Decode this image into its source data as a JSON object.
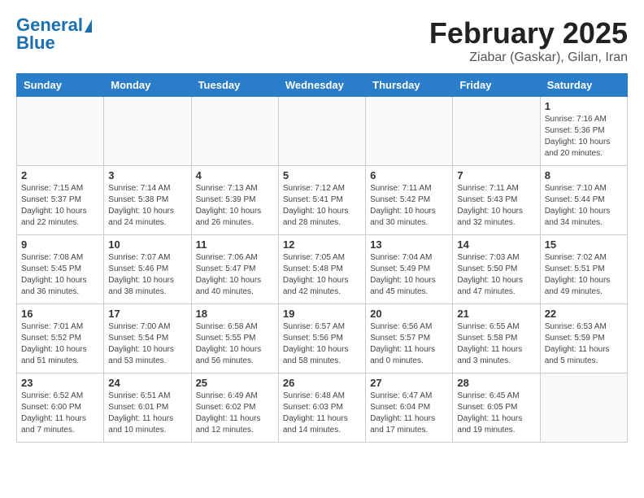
{
  "header": {
    "logo_line1": "General",
    "logo_line2": "Blue",
    "title": "February 2025",
    "subtitle": "Ziabar (Gaskar), Gilan, Iran"
  },
  "weekdays": [
    "Sunday",
    "Monday",
    "Tuesday",
    "Wednesday",
    "Thursday",
    "Friday",
    "Saturday"
  ],
  "weeks": [
    [
      {
        "day": "",
        "info": ""
      },
      {
        "day": "",
        "info": ""
      },
      {
        "day": "",
        "info": ""
      },
      {
        "day": "",
        "info": ""
      },
      {
        "day": "",
        "info": ""
      },
      {
        "day": "",
        "info": ""
      },
      {
        "day": "1",
        "info": "Sunrise: 7:16 AM\nSunset: 5:36 PM\nDaylight: 10 hours and 20 minutes."
      }
    ],
    [
      {
        "day": "2",
        "info": "Sunrise: 7:15 AM\nSunset: 5:37 PM\nDaylight: 10 hours and 22 minutes."
      },
      {
        "day": "3",
        "info": "Sunrise: 7:14 AM\nSunset: 5:38 PM\nDaylight: 10 hours and 24 minutes."
      },
      {
        "day": "4",
        "info": "Sunrise: 7:13 AM\nSunset: 5:39 PM\nDaylight: 10 hours and 26 minutes."
      },
      {
        "day": "5",
        "info": "Sunrise: 7:12 AM\nSunset: 5:41 PM\nDaylight: 10 hours and 28 minutes."
      },
      {
        "day": "6",
        "info": "Sunrise: 7:11 AM\nSunset: 5:42 PM\nDaylight: 10 hours and 30 minutes."
      },
      {
        "day": "7",
        "info": "Sunrise: 7:11 AM\nSunset: 5:43 PM\nDaylight: 10 hours and 32 minutes."
      },
      {
        "day": "8",
        "info": "Sunrise: 7:10 AM\nSunset: 5:44 PM\nDaylight: 10 hours and 34 minutes."
      }
    ],
    [
      {
        "day": "9",
        "info": "Sunrise: 7:08 AM\nSunset: 5:45 PM\nDaylight: 10 hours and 36 minutes."
      },
      {
        "day": "10",
        "info": "Sunrise: 7:07 AM\nSunset: 5:46 PM\nDaylight: 10 hours and 38 minutes."
      },
      {
        "day": "11",
        "info": "Sunrise: 7:06 AM\nSunset: 5:47 PM\nDaylight: 10 hours and 40 minutes."
      },
      {
        "day": "12",
        "info": "Sunrise: 7:05 AM\nSunset: 5:48 PM\nDaylight: 10 hours and 42 minutes."
      },
      {
        "day": "13",
        "info": "Sunrise: 7:04 AM\nSunset: 5:49 PM\nDaylight: 10 hours and 45 minutes."
      },
      {
        "day": "14",
        "info": "Sunrise: 7:03 AM\nSunset: 5:50 PM\nDaylight: 10 hours and 47 minutes."
      },
      {
        "day": "15",
        "info": "Sunrise: 7:02 AM\nSunset: 5:51 PM\nDaylight: 10 hours and 49 minutes."
      }
    ],
    [
      {
        "day": "16",
        "info": "Sunrise: 7:01 AM\nSunset: 5:52 PM\nDaylight: 10 hours and 51 minutes."
      },
      {
        "day": "17",
        "info": "Sunrise: 7:00 AM\nSunset: 5:54 PM\nDaylight: 10 hours and 53 minutes."
      },
      {
        "day": "18",
        "info": "Sunrise: 6:58 AM\nSunset: 5:55 PM\nDaylight: 10 hours and 56 minutes."
      },
      {
        "day": "19",
        "info": "Sunrise: 6:57 AM\nSunset: 5:56 PM\nDaylight: 10 hours and 58 minutes."
      },
      {
        "day": "20",
        "info": "Sunrise: 6:56 AM\nSunset: 5:57 PM\nDaylight: 11 hours and 0 minutes."
      },
      {
        "day": "21",
        "info": "Sunrise: 6:55 AM\nSunset: 5:58 PM\nDaylight: 11 hours and 3 minutes."
      },
      {
        "day": "22",
        "info": "Sunrise: 6:53 AM\nSunset: 5:59 PM\nDaylight: 11 hours and 5 minutes."
      }
    ],
    [
      {
        "day": "23",
        "info": "Sunrise: 6:52 AM\nSunset: 6:00 PM\nDaylight: 11 hours and 7 minutes."
      },
      {
        "day": "24",
        "info": "Sunrise: 6:51 AM\nSunset: 6:01 PM\nDaylight: 11 hours and 10 minutes."
      },
      {
        "day": "25",
        "info": "Sunrise: 6:49 AM\nSunset: 6:02 PM\nDaylight: 11 hours and 12 minutes."
      },
      {
        "day": "26",
        "info": "Sunrise: 6:48 AM\nSunset: 6:03 PM\nDaylight: 11 hours and 14 minutes."
      },
      {
        "day": "27",
        "info": "Sunrise: 6:47 AM\nSunset: 6:04 PM\nDaylight: 11 hours and 17 minutes."
      },
      {
        "day": "28",
        "info": "Sunrise: 6:45 AM\nSunset: 6:05 PM\nDaylight: 11 hours and 19 minutes."
      },
      {
        "day": "",
        "info": ""
      }
    ]
  ]
}
